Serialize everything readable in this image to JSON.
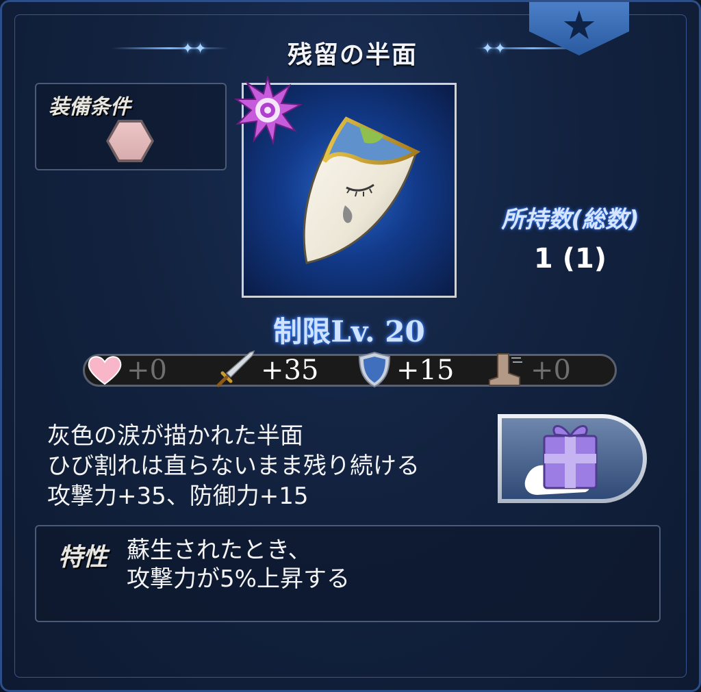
{
  "item": {
    "name": "残留の半面",
    "equip_label": "装備条件",
    "owned_label": "所持数(総数)",
    "owned_value": "1 (1)",
    "limit": "制限Lv. 20"
  },
  "stats": [
    {
      "icon": "heart-icon",
      "value": "+0"
    },
    {
      "icon": "sword-icon",
      "value": "+35"
    },
    {
      "icon": "shield-icon",
      "value": "+15"
    },
    {
      "icon": "boot-icon",
      "value": "+0"
    }
  ],
  "description": {
    "line1": "灰色の涙が描かれた半面",
    "line2": "ひび割れは直らないまま残り続ける",
    "line3": "攻撃力+35、防御力+15"
  },
  "trait": {
    "label": "特性",
    "line1": "蘇生されたとき、",
    "line2": "攻撃力が5%上昇する"
  },
  "colors": {
    "background": "#12223f",
    "accent": "#3b7cff",
    "gift": "#9b7de3"
  }
}
